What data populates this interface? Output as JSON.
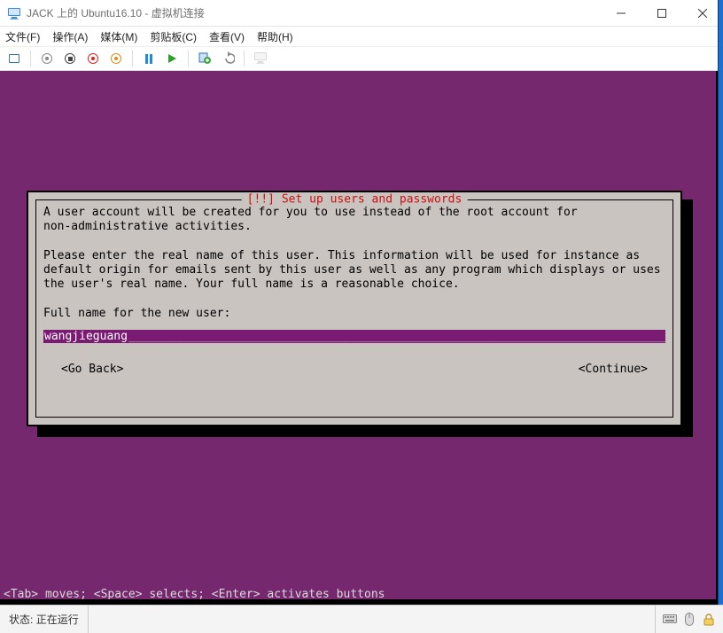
{
  "window": {
    "title": "JACK 上的 Ubuntu16.10 - 虚拟机连接"
  },
  "menubar": {
    "items": [
      {
        "label": "文件(F)"
      },
      {
        "label": "操作(A)"
      },
      {
        "label": "媒体(M)"
      },
      {
        "label": "剪贴板(C)"
      },
      {
        "label": "查看(V)"
      },
      {
        "label": "帮助(H)"
      }
    ]
  },
  "toolbar": {
    "buttons": [
      {
        "name": "ctrl-alt-del-button"
      },
      {
        "name": "start-button"
      },
      {
        "name": "turnoff-button"
      },
      {
        "name": "shutdown-button"
      },
      {
        "name": "save-button"
      },
      {
        "name": "pause-button"
      },
      {
        "name": "reset-button"
      },
      {
        "name": "checkpoint-button"
      },
      {
        "name": "revert-button"
      },
      {
        "name": "enhanced-session-button"
      }
    ]
  },
  "installer": {
    "title": "[!!] Set up users and passwords",
    "body_line1": "A user account will be created for you to use instead of the root account for",
    "body_line2": "non-administrative activities.",
    "body_line3": "Please enter the real name of this user. This information will be used for instance as",
    "body_line4": "default origin for emails sent by this user as well as any program which displays or uses",
    "body_line5": "the user's real name. Your full name is a reasonable choice.",
    "prompt_label": "Full name for the new user:",
    "input_value": "wangjieguang",
    "go_back_label": "<Go Back>",
    "continue_label": "<Continue>",
    "help_line": "<Tab> moves; <Space> selects; <Enter> activates buttons"
  },
  "statusbar": {
    "label_prefix": "状态:",
    "state": "正在运行"
  }
}
